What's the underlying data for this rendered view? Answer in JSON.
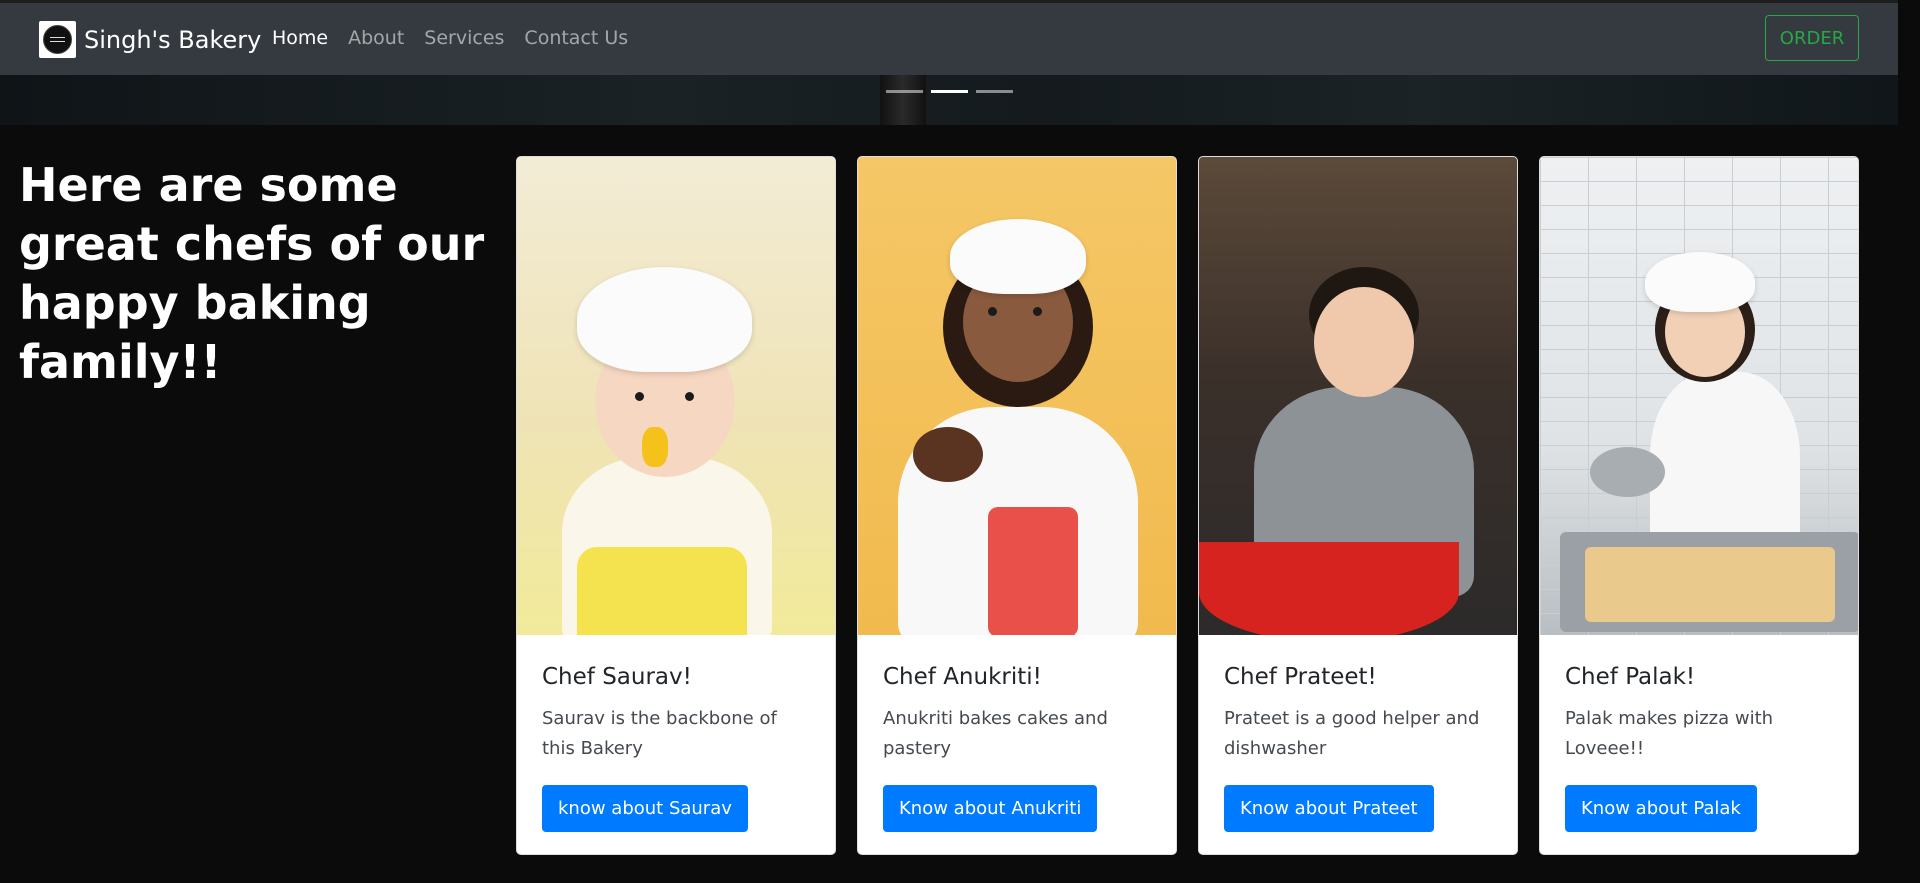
{
  "navbar": {
    "brand": "Singh's Bakery",
    "links": [
      {
        "label": "Home",
        "active": true
      },
      {
        "label": "About",
        "active": false
      },
      {
        "label": "Services",
        "active": false
      },
      {
        "label": "Contact Us",
        "active": false
      }
    ],
    "order_label": "ORDER"
  },
  "carousel": {
    "slide_count": 3,
    "active_slide": 2
  },
  "heading": "Here are some great chefs of our happy baking family!!",
  "chefs": [
    {
      "title": "Chef Saurav!",
      "text": "Saurav is the backbone of this Bakery",
      "button": "know about Saurav"
    },
    {
      "title": "Chef Anukriti!",
      "text": "Anukriti bakes cakes and pastery",
      "button": "Know about Anukriti"
    },
    {
      "title": "Chef Prateet!",
      "text": "Prateet is a good helper and dishwasher",
      "button": "Know about Prateet"
    },
    {
      "title": "Chef Palak!",
      "text": "Palak makes pizza with Loveee!!",
      "button": "Know about Palak"
    }
  ],
  "colors": {
    "navbar_bg": "#343a40",
    "page_bg": "#0b0b0b",
    "primary_button": "#007bff",
    "order_outline": "#28a745"
  }
}
